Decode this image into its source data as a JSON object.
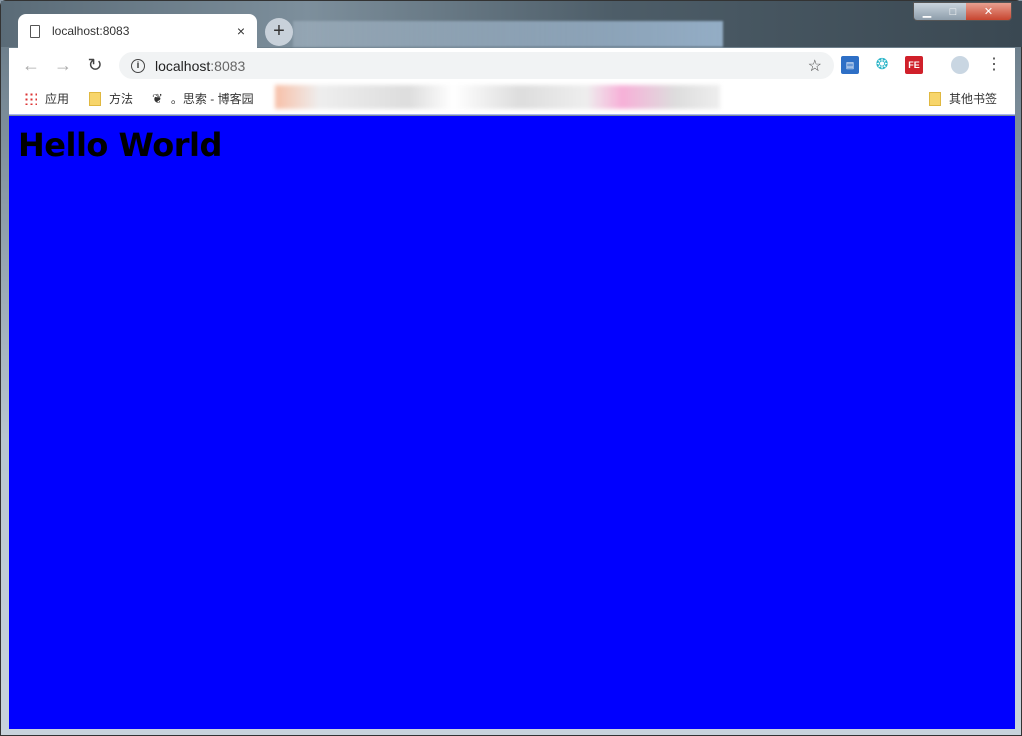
{
  "browser": {
    "tab": {
      "title": "localhost:8083",
      "close": "×"
    },
    "new_tab": "+",
    "address": {
      "host": "localhost",
      "port": ":8083"
    },
    "bookmarks": [
      {
        "label": "应用",
        "icon": "apps-grid-icon"
      },
      {
        "label": "方法",
        "icon": "folder-icon"
      },
      {
        "label": "。思索 - 博客园",
        "icon": "cnblogs-icon"
      }
    ],
    "other_bookmarks": "其他书签",
    "extensions": [
      "save-icon",
      "globe-icon",
      "fe-helper-icon",
      "weather-icon"
    ],
    "ext_fe_label": "FE"
  },
  "page": {
    "heading": "Hello World",
    "background": "#0000ff"
  }
}
